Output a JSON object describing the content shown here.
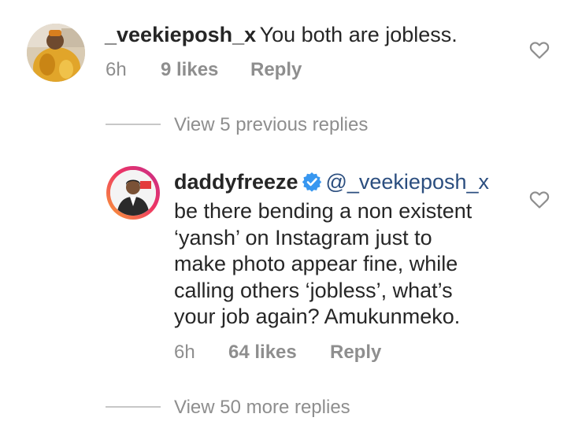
{
  "comment1": {
    "username": "_veekieposh_x",
    "text": "You both are jobless.",
    "time": "6h",
    "likes": "9 likes",
    "reply": "Reply"
  },
  "view_previous": "View 5 previous replies",
  "comment2": {
    "username": "daddyfreeze",
    "mention": "@_veekieposh_x",
    "lines": [
      "be there bending a non existent",
      "‘yansh’ on Instagram just to",
      "make photo appear fine, while",
      "calling others ‘jobless’, what’s",
      "your job again? Amukunmeko."
    ],
    "time": "6h",
    "likes": "64 likes",
    "reply": "Reply"
  },
  "view_more": "View 50 more replies",
  "colors": {
    "verified": "#3897f0",
    "mention": "#2b4e7f",
    "meta": "#8e8e8e"
  },
  "icons": {
    "like": "heart-icon",
    "verified": "verified-badge-icon"
  }
}
